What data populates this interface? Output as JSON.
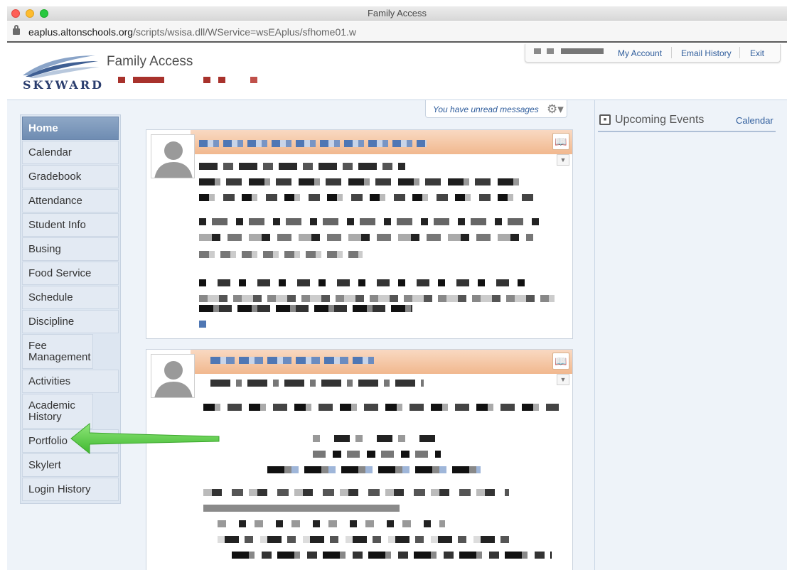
{
  "window": {
    "title": "Family Access"
  },
  "address": {
    "host": "eaplus.altonschools.org",
    "path": "/scripts/wsisa.dll/WService=wsEAplus/sfhome01.w"
  },
  "header": {
    "logo_text": "SKYWARD",
    "app_name": "Family Access",
    "links": [
      "My Account",
      "Email History",
      "Exit"
    ]
  },
  "nav": {
    "items": [
      {
        "label": "Home",
        "active": true
      },
      {
        "label": "Calendar"
      },
      {
        "label": "Gradebook"
      },
      {
        "label": "Attendance"
      },
      {
        "label": "Student Info"
      },
      {
        "label": "Busing"
      },
      {
        "label": "Food Service"
      },
      {
        "label": "Schedule"
      },
      {
        "label": "Discipline"
      },
      {
        "label": "Fee Management"
      },
      {
        "label": "Activities"
      },
      {
        "label": "Academic History"
      },
      {
        "label": "Portfolio"
      },
      {
        "label": "Skylert"
      },
      {
        "label": "Login History"
      }
    ]
  },
  "feed": {
    "unread_label": "You have unread messages"
  },
  "events": {
    "title": "Upcoming Events",
    "calendar_link": "Calendar"
  },
  "colors": {
    "accent_link": "#2f5d9c",
    "nav_active": "#7b96bb",
    "arrow": "#5fd14a",
    "message_header": "#f3c29d"
  }
}
